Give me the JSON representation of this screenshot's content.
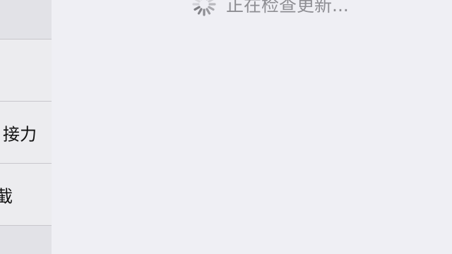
{
  "sidebar": {
    "items": [
      {
        "label": ""
      },
      {
        "label": "接力"
      },
      {
        "label": "截"
      }
    ]
  },
  "update": {
    "status_text": "正在检查更新..."
  }
}
